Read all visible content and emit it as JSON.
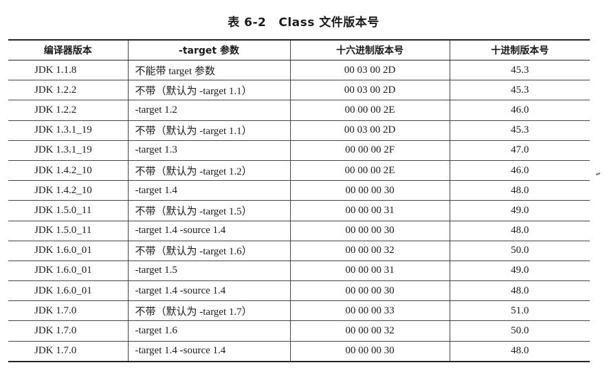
{
  "caption": {
    "number": "表 6-2",
    "title": "Class 文件版本号"
  },
  "headers": [
    "编译器版本",
    "-target 参数",
    "十六进制版本号",
    "十进制版本号"
  ],
  "rows": [
    {
      "jdk": "JDK 1.1.8",
      "target": "不能带 target 参数",
      "hex": "00 03 00 2D",
      "dec": "45.3"
    },
    {
      "jdk": "JDK 1.2.2",
      "target": "不带（默认为 -target 1.1）",
      "hex": "00 03 00 2D",
      "dec": "45.3"
    },
    {
      "jdk": "JDK 1.2.2",
      "target": "-target 1.2",
      "hex": "00 00 00 2E",
      "dec": "46.0"
    },
    {
      "jdk": "JDK 1.3.1_19",
      "target": "不带（默认为 -target 1.1）",
      "hex": "00 03 00 2D",
      "dec": "45.3"
    },
    {
      "jdk": "JDK 1.3.1_19",
      "target": "-target 1.3",
      "hex": "00 00 00 2F",
      "dec": "47.0"
    },
    {
      "jdk": "JDK 1.4.2_10",
      "target": "不带（默认为 -target 1.2）",
      "hex": "00 00 00 2E",
      "dec": "46.0"
    },
    {
      "jdk": "JDK 1.4.2_10",
      "target": "-target 1.4",
      "hex": "00 00 00 30",
      "dec": "48.0"
    },
    {
      "jdk": "JDK 1.5.0_11",
      "target": "不带（默认为 -target 1.5）",
      "hex": "00 00 00 31",
      "dec": "49.0"
    },
    {
      "jdk": "JDK 1.5.0_11",
      "target": "-target 1.4 -source 1.4",
      "hex": "00 00 00 30",
      "dec": "48.0"
    },
    {
      "jdk": "JDK 1.6.0_01",
      "target": "不带（默认为 -target 1.6）",
      "hex": "00 00 00 32",
      "dec": "50.0"
    },
    {
      "jdk": "JDK 1.6.0_01",
      "target": "-target 1.5",
      "hex": "00 00 00 31",
      "dec": "49.0"
    },
    {
      "jdk": "JDK 1.6.0_01",
      "target": "-target 1.4 -source 1.4",
      "hex": "00 00 00 30",
      "dec": "48.0"
    },
    {
      "jdk": "JDK 1.7.0",
      "target": "不带（默认为 -target 1.7）",
      "hex": "00 00 00 33",
      "dec": "51.0"
    },
    {
      "jdk": "JDK 1.7.0",
      "target": "-target 1.6",
      "hex": "00 00 00 32",
      "dec": "50.0"
    },
    {
      "jdk": "JDK 1.7.0",
      "target": "-target 1.4 -source 1.4",
      "hex": "00 00 00 30",
      "dec": "48.0"
    }
  ]
}
